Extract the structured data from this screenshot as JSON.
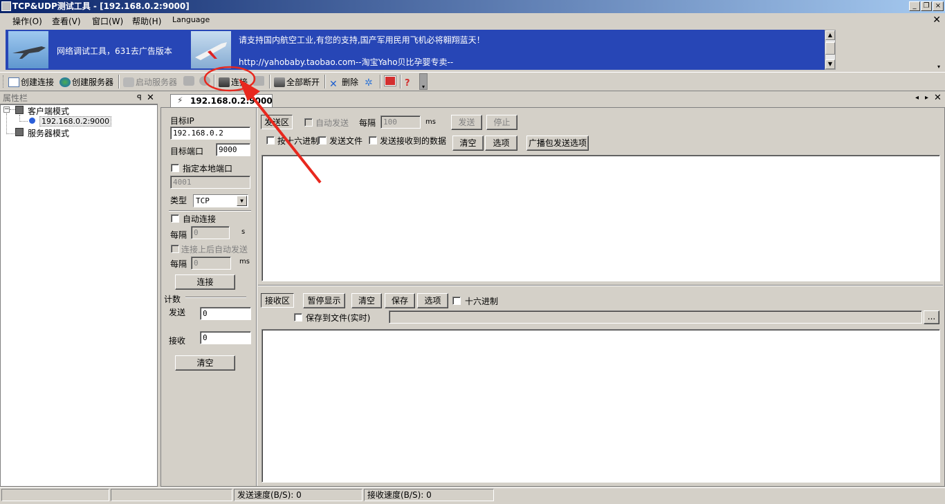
{
  "window": {
    "title": "TCP&UDP测试工具 - [192.168.0.2:9000]"
  },
  "menu": {
    "items": [
      "操作(O)",
      "查看(V)",
      "窗口(W)",
      "帮助(H)",
      "Language"
    ]
  },
  "banner": {
    "left_text": "网络调试工具，631去广告版本",
    "line1": "请支持国内航空工业,有您的支持,国产军用民用飞机必将翱翔蓝天！",
    "line2": "http://yahobaby.taobao.com--淘宝Yaho贝比孕婴专卖--"
  },
  "toolbar": {
    "create_conn": "创建连接",
    "create_server": "创建服务器",
    "start_server": "启动服务器",
    "connect": "连接",
    "disconnect_all": "全部断开",
    "delete": "删除"
  },
  "sidebar": {
    "title": "属性栏",
    "pin": "ᵖ",
    "tree": {
      "client": "客户端模式",
      "conn": "192.168.0.2:9000",
      "server": "服务器模式"
    }
  },
  "tab": {
    "label": "192.168.0.2:9000"
  },
  "left": {
    "target_ip_label": "目标IP",
    "target_ip": "192.168.0.2",
    "target_port_label": "目标端口",
    "target_port": "9000",
    "local_port_label": "指定本地端口",
    "local_port": "4001",
    "type_label": "类型",
    "type_value": "TCP",
    "auto_conn_label": "自动连接",
    "interval_label": "每隔",
    "interval1": "0",
    "unit_s": "s",
    "auto_send_label": "连接上后自动发送",
    "interval2": "0",
    "unit_ms": "ms",
    "connect_btn": "连接",
    "count_label": "计数",
    "send_label": "发送",
    "send_count": "0",
    "recv_label": "接收",
    "recv_count": "0",
    "clear_btn": "清空"
  },
  "send": {
    "area_label": "发送区",
    "auto_send": "自动发送",
    "interval_label": "每隔",
    "interval": "100",
    "unit": "ms",
    "send_btn": "发送",
    "stop_btn": "停止",
    "hex_label": "按十六进制",
    "send_file": "发送文件",
    "send_recv": "发送接收到的数据",
    "clear_btn": "清空",
    "options_btn": "选项",
    "broadcast_btn": "广播包发送选项"
  },
  "recv": {
    "area_label": "接收区",
    "pause_btn": "暂停显示",
    "clear_btn": "清空",
    "save_btn": "保存",
    "options_btn": "选项",
    "hex_label": "十六进制",
    "save_file": "保存到文件(实时)",
    "browse": "..."
  },
  "status": {
    "send_speed": "发送速度(B/S): 0",
    "recv_speed": "接收速度(B/S): 0"
  },
  "colors": {
    "banner_bg": "#2746b6",
    "title_bg": "#0a246a",
    "annotation": "#e8281e"
  }
}
